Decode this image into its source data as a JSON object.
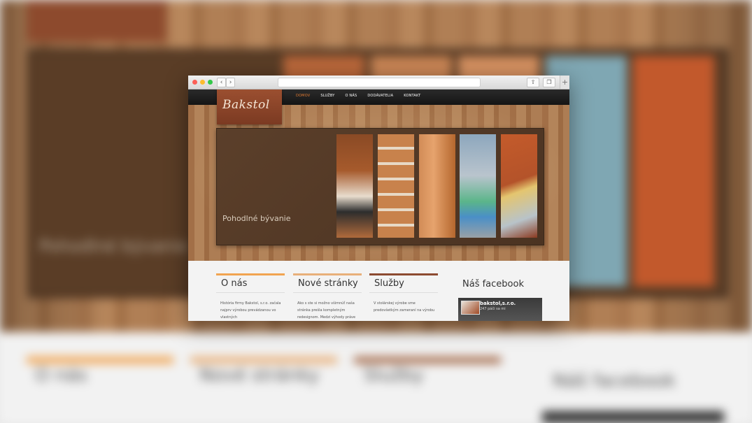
{
  "colors": {
    "accent_orange": "#f1a451",
    "accent_peach": "#e8b07a",
    "accent_brown": "#8c4a30",
    "nav_active": "#e07a32",
    "logo_bg": "#8d4a2d"
  },
  "site": {
    "logo": "Bakstol",
    "nav": [
      {
        "label": "DOMOV",
        "active": true
      },
      {
        "label": "SLUŽBY",
        "active": false
      },
      {
        "label": "O NÁS",
        "active": false
      },
      {
        "label": "DODÁVATELIA",
        "active": false
      },
      {
        "label": "KONTAKT",
        "active": false
      }
    ],
    "slider": {
      "caption": "Pohodlné bývanie",
      "images": [
        "kitchen-image",
        "cabinet-image",
        "wardrobe-door-image",
        "table-image",
        "roof-image"
      ]
    },
    "columns": [
      {
        "title": "O nás",
        "text": "História firmy Bakstol, s.r.o. začala najprv výrobou prevádzanou vo vlastných"
      },
      {
        "title": "Nové stránky",
        "text": "Ako s ste si možno všimnúť naša stránka prešla kompletným redesignom. Medzi výhody práve"
      },
      {
        "title": "Služby",
        "text": "V stolárskej výrobe sme predovšetkým zameraní na výrobu"
      }
    ],
    "facebook": {
      "title": "Náš facebook",
      "page_name": "bakstol,s.r.o.",
      "likes": "247 páči sa mi"
    }
  },
  "browser": {
    "back_icon": "chevron-left-icon",
    "forward_icon": "chevron-right-icon",
    "share_icon": "share-icon",
    "tabs_icon": "tabs-icon",
    "new_tab": "+"
  }
}
